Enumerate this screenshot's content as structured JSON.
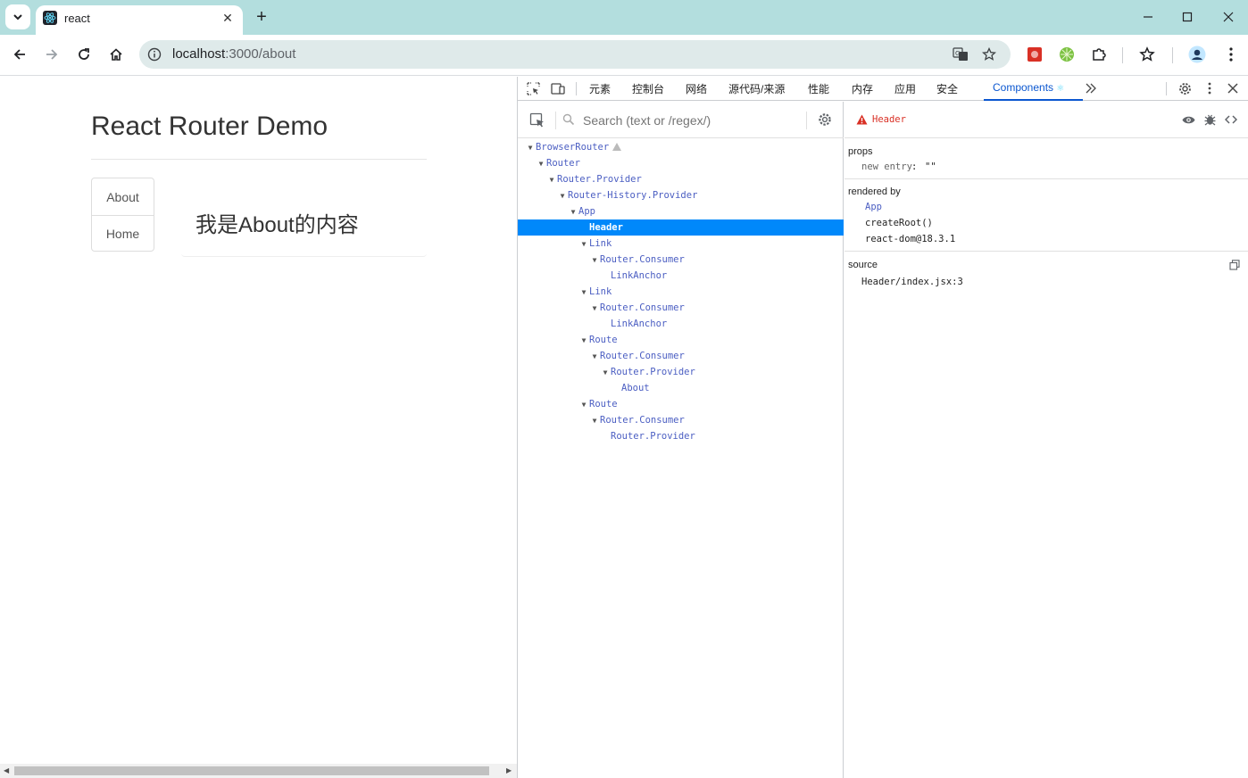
{
  "browser": {
    "tab_title": "react",
    "url_host": "localhost",
    "url_path": ":3000/about"
  },
  "page": {
    "title": "React Router Demo",
    "nav": [
      "About",
      "Home"
    ],
    "content": "我是About的内容"
  },
  "devtools": {
    "tabs": [
      "元素",
      "控制台",
      "网络",
      "源代码/来源",
      "性能",
      "内存",
      "应用",
      "安全",
      "Components"
    ],
    "active_tab": "Components",
    "search_placeholder": "Search (text or /regex/)",
    "tree": [
      {
        "label": "BrowserRouter",
        "depth": 0,
        "arrow": true,
        "warn": true
      },
      {
        "label": "Router",
        "depth": 1,
        "arrow": true
      },
      {
        "label": "Router.Provider",
        "depth": 2,
        "arrow": true
      },
      {
        "label": "Router-History.Provider",
        "depth": 3,
        "arrow": true
      },
      {
        "label": "App",
        "depth": 4,
        "arrow": true
      },
      {
        "label": "Header",
        "depth": 5,
        "arrow": false,
        "selected": true
      },
      {
        "label": "Link",
        "depth": 5,
        "arrow": true
      },
      {
        "label": "Router.Consumer",
        "depth": 6,
        "arrow": true
      },
      {
        "label": "LinkAnchor",
        "depth": 7,
        "arrow": false
      },
      {
        "label": "Link",
        "depth": 5,
        "arrow": true
      },
      {
        "label": "Router.Consumer",
        "depth": 6,
        "arrow": true
      },
      {
        "label": "LinkAnchor",
        "depth": 7,
        "arrow": false
      },
      {
        "label": "Route",
        "depth": 5,
        "arrow": true
      },
      {
        "label": "Router.Consumer",
        "depth": 6,
        "arrow": true
      },
      {
        "label": "Router.Provider",
        "depth": 7,
        "arrow": true
      },
      {
        "label": "About",
        "depth": 8,
        "arrow": false
      },
      {
        "label": "Route",
        "depth": 5,
        "arrow": true
      },
      {
        "label": "Router.Consumer",
        "depth": 6,
        "arrow": true
      },
      {
        "label": "Router.Provider",
        "depth": 7,
        "arrow": false
      }
    ],
    "inspector": {
      "component": "Header",
      "props_title": "props",
      "prop_key": "new entry",
      "prop_value": "\"\"",
      "rendered_by_title": "rendered by",
      "rendered_by": [
        "App",
        "createRoot()",
        "react-dom@18.3.1"
      ],
      "source_title": "source",
      "source_file": "Header/index.jsx:3"
    }
  }
}
